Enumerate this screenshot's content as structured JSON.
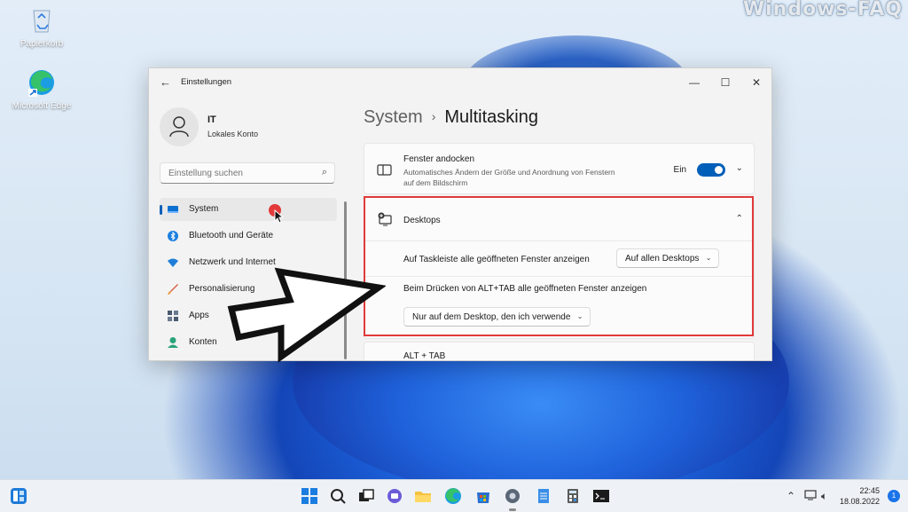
{
  "watermark": "Windows-FAQ",
  "desktop": {
    "icons": [
      {
        "label": "Papierkorb",
        "icon": "recycle-bin-icon"
      },
      {
        "label": "Microsoft Edge",
        "icon": "edge-icon"
      }
    ]
  },
  "window": {
    "title": "Einstellungen",
    "back_icon": "back-arrow-icon",
    "controls": [
      "minimize-icon",
      "maximize-icon",
      "close-icon"
    ]
  },
  "user": {
    "name": "IT",
    "account": "Lokales Konto"
  },
  "search": {
    "placeholder": "Einstellung suchen"
  },
  "nav": [
    {
      "label": "System",
      "icon": "monitor-icon",
      "selected": true,
      "color": "#0a6fd0"
    },
    {
      "label": "Bluetooth und Geräte",
      "icon": "bluetooth-icon",
      "selected": false,
      "color": "#1a7fe0"
    },
    {
      "label": "Netzwerk und Internet",
      "icon": "wifi-icon",
      "selected": false,
      "color": "#1f7fd8"
    },
    {
      "label": "Personalisierung",
      "icon": "brush-icon",
      "selected": false,
      "color": "#d8604a"
    },
    {
      "label": "Apps",
      "icon": "apps-icon",
      "selected": false,
      "color": "#4a5a70"
    },
    {
      "label": "Konten",
      "icon": "person-icon",
      "selected": false,
      "color": "#2aa37a"
    }
  ],
  "breadcrumb": {
    "parent": "System",
    "separator": "›",
    "current": "Multitasking"
  },
  "snap": {
    "title": "Fenster andocken",
    "description": "Automatisches Ändern der Größe und Anordnung von Fenstern auf dem Bildschirm",
    "toggle_label": "Ein",
    "toggle_on": true
  },
  "desktops": {
    "title": "Desktops",
    "taskbar_label": "Auf Taskleiste alle geöffneten Fenster anzeigen",
    "taskbar_value": "Auf allen Desktops",
    "alttab_label": "Beim Drücken von ALT+TAB alle geöffneten Fenster anzeigen",
    "alttab_value": "Nur auf dem Desktop, den ich verwende"
  },
  "next_section": {
    "title": "ALT + TAB"
  },
  "colors": {
    "accent": "#005fb8",
    "highlight_box": "#e03a3a"
  },
  "taskbar": {
    "apps": [
      "start-icon",
      "search-icon",
      "task-view-icon",
      "chat-icon",
      "file-explorer-icon",
      "edge-icon",
      "store-icon",
      "settings-icon",
      "notepad-icon",
      "calculator-icon",
      "terminal-icon"
    ],
    "tray": [
      "chevron-up-icon",
      "network-icon",
      "volume-icon"
    ],
    "time": "22:45",
    "date": "18.08.2022",
    "notifications": "1"
  }
}
